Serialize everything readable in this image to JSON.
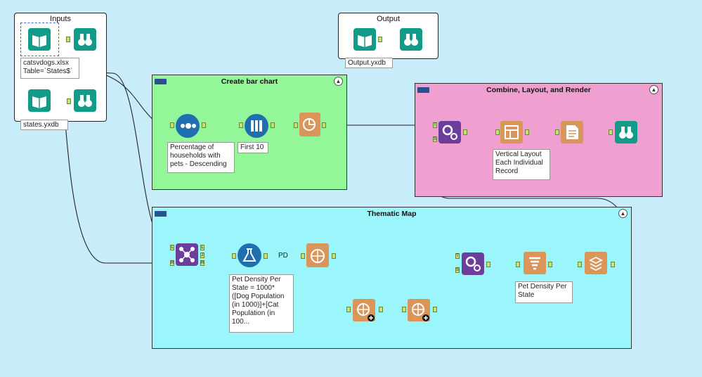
{
  "workflows": {
    "inputs": {
      "title": "Inputs",
      "file1": "catsvdogs.xlsx",
      "file1_table": "Table=`States$`",
      "file2": "states.yxdb"
    },
    "output": {
      "title": "Output",
      "file": "Output.yxdb"
    }
  },
  "containers": {
    "bar_chart": {
      "title": "Create bar chart",
      "collapse": "▲"
    },
    "combine": {
      "title": "Combine, Layout, and Render",
      "collapse": "▲"
    },
    "thematic": {
      "title": "Thematic Map",
      "collapse": "▲"
    }
  },
  "tools": {
    "sort": {
      "label_lines": [
        "Percentage of",
        "households with",
        "pets - Descending"
      ]
    },
    "sample": {
      "label": "First 10"
    },
    "layout": {
      "label_lines": [
        "Vertical Layout",
        "Each Individual",
        "Record"
      ]
    },
    "formula": {
      "label_lines": [
        "Pet Density Per",
        "State = 1000*",
        "([Dog Population",
        "(in 1000)]+[Cat",
        "Population (in",
        "100..."
      ]
    },
    "pd_tag": "PD",
    "table": {
      "label_lines": [
        "Pet Density Per",
        "State"
      ]
    }
  },
  "anchors": {
    "L": "L",
    "R": "R",
    "J": "J",
    "T": "T",
    "S": "S"
  },
  "colors": {
    "background": "#c9ecfb",
    "bar_chart": "#93f79a",
    "combine": "#f0a0d0",
    "thematic": "#9af6fb",
    "teal": "#139b8a",
    "orange": "#d9955a",
    "purple": "#6c3e9c",
    "blue": "#1f6fb0"
  }
}
